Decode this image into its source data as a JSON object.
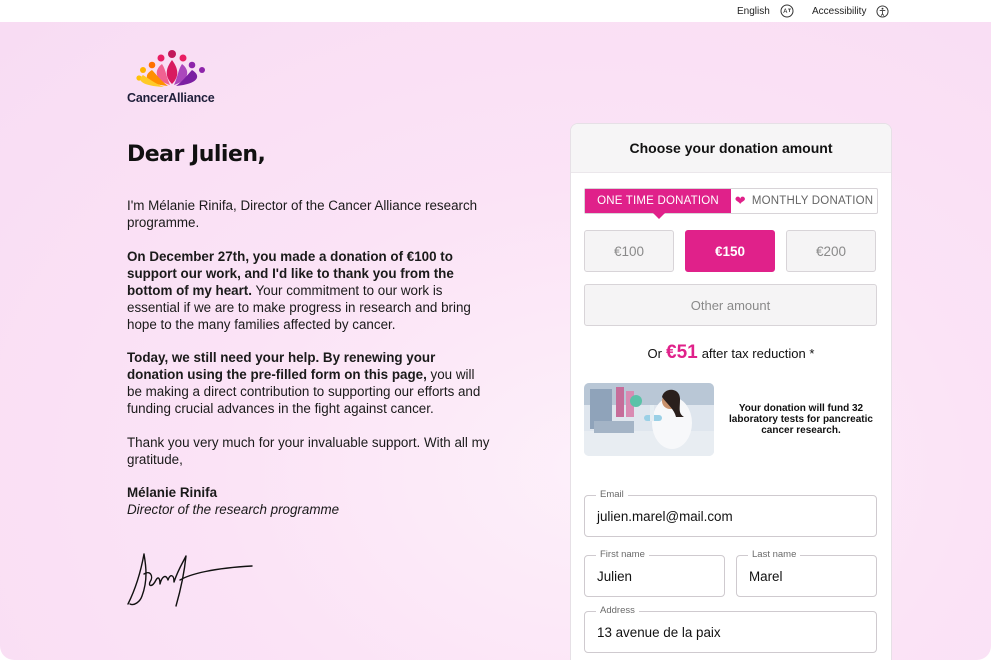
{
  "topbar": {
    "language_label": "English",
    "accessibility_label": "Accessibility"
  },
  "brand": {
    "name": "CancerAlliance",
    "accent_color": "#e0218a"
  },
  "letter": {
    "greeting": "Dear Julien,",
    "p1": "I'm Mélanie Rinifa, Director of the Cancer Alliance research programme.",
    "p2_bold": "On December 27th, you made a donation of €100 to support our work, and I'd like to thank you from the bottom of my heart.",
    "p2_rest": " Your commitment to our work is essential if we are to make progress in research and bring hope to the many families affected by cancer.",
    "p3_bold": "Today, we still need your help. By renewing your donation using the pre-filled form on this page,",
    "p3_rest": " you will be making a direct contribution to supporting our efforts and funding crucial advances in the fight against cancer.",
    "p4": "Thank you very much for your invaluable support. With all my gratitude,",
    "signer_name": "Mélanie Rinifa",
    "signer_title": "Director of the research programme"
  },
  "donation": {
    "title": "Choose your donation amount",
    "frequency": {
      "one_time": "ONE TIME DONATION",
      "monthly": "MONTHLY DONATION",
      "selected": "one_time"
    },
    "amounts": [
      "€100",
      "€150",
      "€200"
    ],
    "selected_amount": "€150",
    "other_amount_label": "Other amount",
    "tax": {
      "prefix": "Or",
      "amount": "€51",
      "suffix": "after tax reduction *"
    },
    "impact_text": "Your donation will fund 32 laboratory tests for pancreatic cancer research.",
    "form": {
      "email_label": "Email",
      "email_value": "julien.marel@mail.com",
      "first_name_label": "First name",
      "first_name_value": "Julien",
      "last_name_label": "Last name",
      "last_name_value": "Marel",
      "address_label": "Address",
      "address_value": "13 avenue de la paix"
    }
  }
}
